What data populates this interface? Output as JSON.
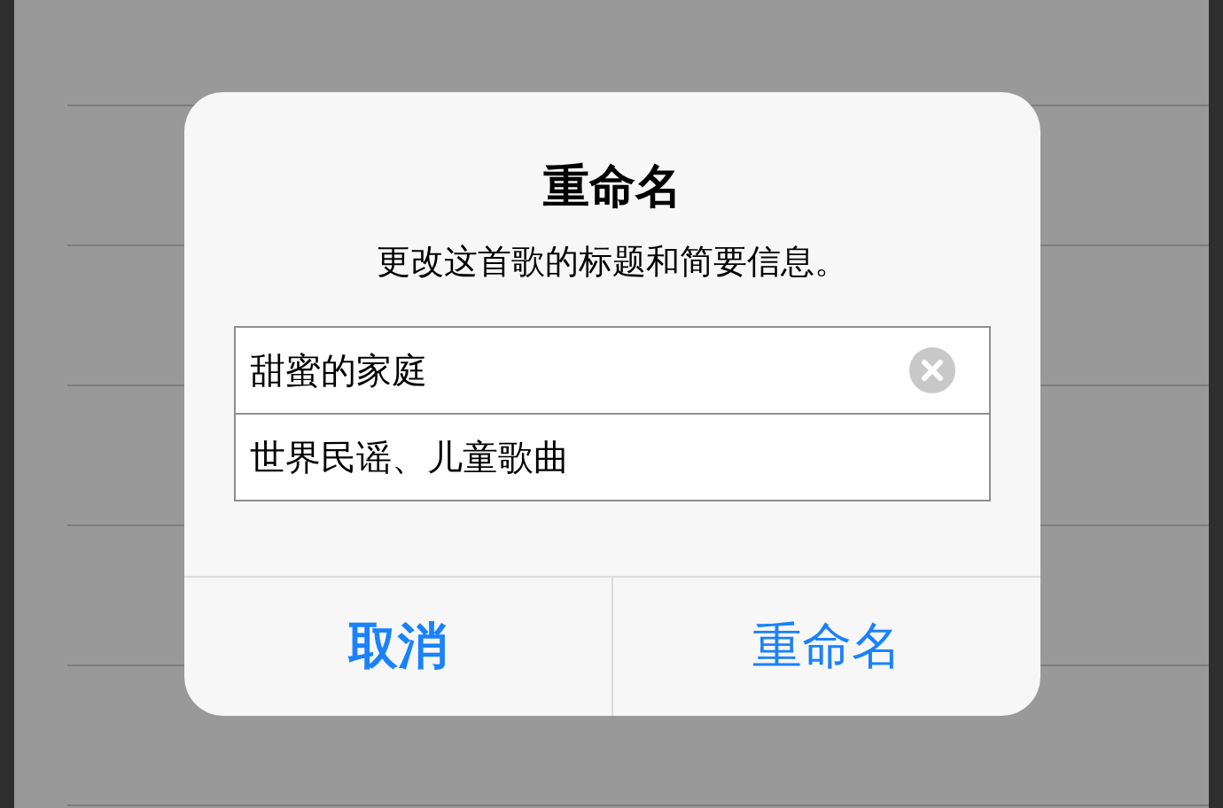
{
  "dialog": {
    "title": "重命名",
    "message": "更改这首歌的标题和简要信息。",
    "fields": [
      {
        "value": "甜蜜的家庭",
        "clear_button": true
      },
      {
        "value": "世界民谣、儿童歌曲",
        "clear_button": false
      }
    ],
    "buttons": [
      {
        "label": "取消",
        "kind": "cancel"
      },
      {
        "label": "重命名",
        "kind": "default"
      }
    ]
  }
}
